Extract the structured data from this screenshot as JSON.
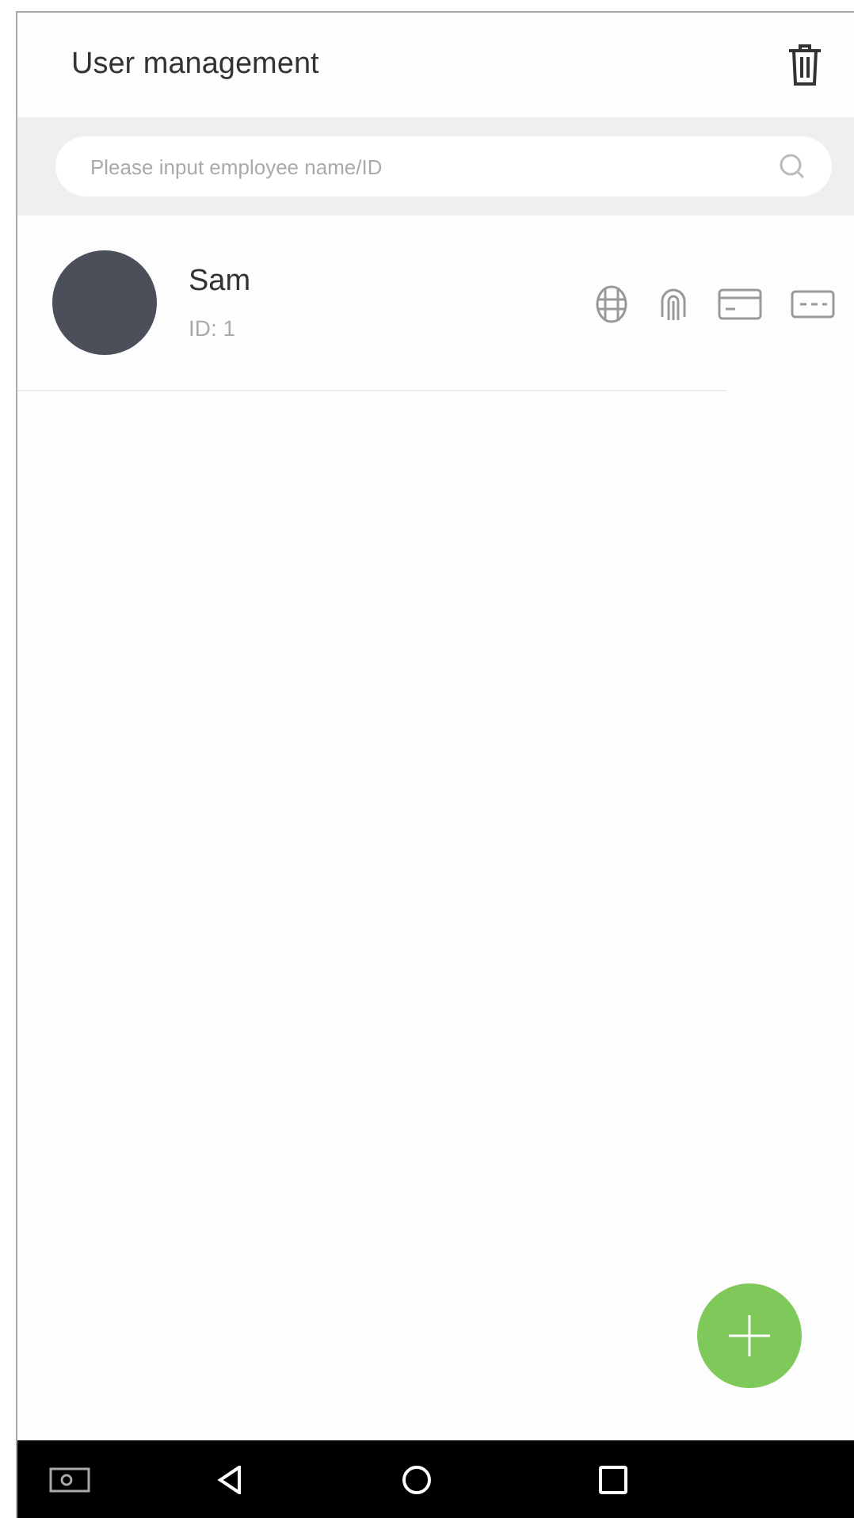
{
  "header": {
    "title": "User management"
  },
  "search": {
    "placeholder": "Please input employee name/ID"
  },
  "users": [
    {
      "name": "Sam",
      "id": "ID: 1"
    }
  ]
}
